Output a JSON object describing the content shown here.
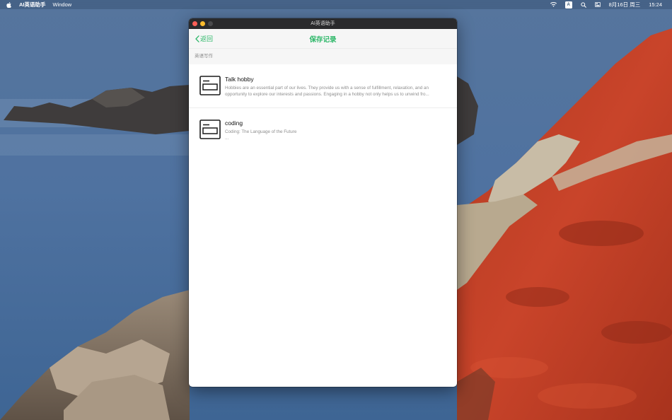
{
  "menubar": {
    "apple_icon": "apple-logo-icon",
    "app_name": "AI英语助手",
    "menus": [
      "Window"
    ],
    "status_icons": [
      "wifi-icon",
      "input-method-icon",
      "search-icon",
      "control-center-icon"
    ],
    "ime_label": "A",
    "date": "8月16日 周三",
    "time": "15:24"
  },
  "window": {
    "title": "AI英语助手",
    "traffic_lights": {
      "close": "#fe5f57",
      "minimize": "#febc2e",
      "zoom": "#4a4a4c"
    },
    "nav": {
      "back_label": "返回",
      "title": "保存记录",
      "accent_color": "#2fb86a"
    },
    "section_label": "英语写作",
    "records": [
      {
        "icon": "document-card-icon",
        "title": "Talk hobby",
        "description": "Hobbies are an essential part of our lives. They provide us with a sense of fulfillment, relaxation, and an opportunity to explore our interests and passions. Engaging in a hobby not only helps us to unwind fro...",
        "description_extra": ""
      },
      {
        "icon": "document-card-icon",
        "title": "coding",
        "description": "Coding: The Language of the Future",
        "description_extra": "..."
      }
    ]
  }
}
